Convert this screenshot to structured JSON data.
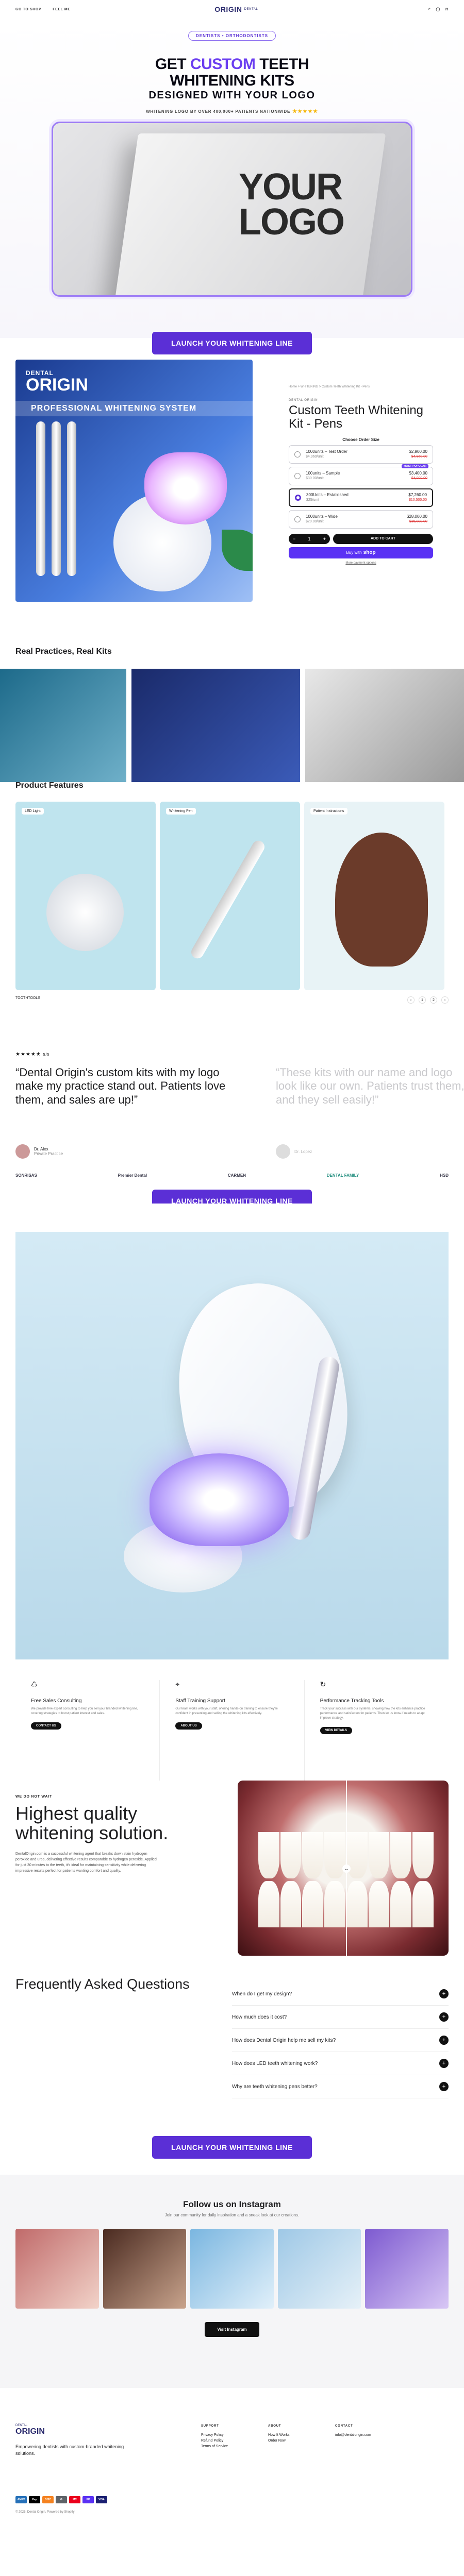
{
  "header": {
    "nav": [
      "GO TO SHOP",
      "FEEL ME"
    ],
    "logo": "ORIGIN",
    "logo_small": "DENTAL"
  },
  "hero": {
    "pill": "DENTISTS • ORTHODONTISTS",
    "title_pre": "GET ",
    "title_accent": "CUSTOM",
    "title_post": " TEETH",
    "title_line2": "WHITENING KITS",
    "subtitle": "DESIGNED WITH YOUR LOGO",
    "trust": "WHITENING LOGO BY OVER 400,000+ PATIENTS NATIONWIDE",
    "stars": "★★★★★",
    "card_text": "YOUR LOGO",
    "cta": "LAUNCH YOUR WHITENING LINE"
  },
  "product": {
    "img_brand_small": "DENTAL",
    "img_brand": "ORIGIN",
    "img_band": "PROFESSIONAL WHITENING SYSTEM",
    "crumb": "Home > WHITENING > Custom Teeth Whitening Kit - Pens",
    "category": "DENTAL ORIGIN",
    "title": "Custom Teeth Whitening Kit - Pens",
    "order_size": "Choose Order Size",
    "options": [
      {
        "name": "1000units – Test Order",
        "sub": "$4,960/unit",
        "price": "$2,900.00",
        "old": "$4,960.00",
        "tag": ""
      },
      {
        "name": "100units – Sample",
        "sub": "$30.00/unit",
        "price": "$3,400.00",
        "old": "$4,000.00",
        "tag": "MOST POPULAR"
      },
      {
        "name": "300Units – Established",
        "sub": "$25/unit",
        "price": "$7,260.00",
        "old": "$10,500.00",
        "tag": ""
      },
      {
        "name": "1000units – Wide",
        "sub": "$20.00/unit",
        "price": "$28,000.00",
        "old": "$35,000.00",
        "tag": ""
      }
    ],
    "qty": "1",
    "atc": "ADD TO CART",
    "shop_pre": "Buy with",
    "shop_brand": "shop",
    "more": "More payment options"
  },
  "real": {
    "title": "Real Practices, Real Kits"
  },
  "features": {
    "title": "Product Features",
    "cards": [
      {
        "label": "LED Light"
      },
      {
        "label": "Whitening Pen"
      },
      {
        "label": "Patient Instructions"
      }
    ],
    "page": "TOOTHTOOLS",
    "pager": [
      "1",
      "2"
    ]
  },
  "testimonial": {
    "stars": "★★★★★",
    "count": "5/5",
    "quote": "“Dental Origin's custom kits with my logo make my practice stand out. Patients love them, and sales are up!”",
    "quote2": "“These kits with our name and logo look like our own. Patients trust them, and they sell easily!”",
    "author": "Dr. Alex",
    "author_role": "Private Practice",
    "author2": "Dr. Lopez",
    "logos": [
      "SONRISAS",
      "Premier Dental",
      "CARMEN",
      "DENTAL FAMILY",
      "HSD"
    ]
  },
  "cta2": "LAUNCH YOUR WHITENING LINE",
  "services": [
    {
      "icon": "♺",
      "title": "Free Sales Consulting",
      "text": "We provide free expert consulting to help you sell your branded whitening line, covering strategies to boost patient interest and sales.",
      "btn": "CONTACT US"
    },
    {
      "icon": "⌖",
      "title": "Staff Training Support",
      "text": "Our team works with your staff, offering hands-on training to ensure they're confident in presenting and selling the whitening kits effectively.",
      "btn": "ABOUT US"
    },
    {
      "icon": "↻",
      "title": "Performance Tracking Tools",
      "text": "Track your success with our systems, showing how the kits enhance practice performance and satisfaction for patients. Then let us know if needs to adapt improve strategy.",
      "btn": "VIEW DETAILS"
    }
  ],
  "quality": {
    "kicker": "WE DO NOT WAIT",
    "title": "Highest quality whitening solution.",
    "text": "DentalOrigin.com is a successful whitening agent that breaks down stain hydrogen peroxide and urea, delivering effective results comparable to hydrogen peroxide. Applied for just 30 minutes to the teeth, it's ideal for maintaining sensitivity while delivering impressive results perfect for patients wanting comfort and quality."
  },
  "faq": {
    "title": "Frequently Asked Questions",
    "items": [
      "When do I get my design?",
      "How much does it cost?",
      "How does Dental Origin help me sell my kits?",
      "How does LED teeth whitening work?",
      "Why are teeth whitening pens better?"
    ]
  },
  "cta3": "LAUNCH YOUR WHITENING LINE",
  "instagram": {
    "title": "Follow us on Instagram",
    "sub": "Join our community for daily inspiration and a sneak look at our creations.",
    "btn": "Visit Instagram"
  },
  "footer": {
    "tagline": "Empowering dentists with custom-branded whitening solutions.",
    "cols": [
      {
        "head": "SUPPORT",
        "items": [
          "Privacy Policy",
          "Refund Policy",
          "Terms of Service"
        ]
      },
      {
        "head": "ABOUT",
        "items": [
          "How It Works",
          "Order Now"
        ]
      },
      {
        "head": "CONTACT",
        "items": [
          "info@dentalorigin.com"
        ]
      }
    ],
    "copyright": "© 2025, Dental Origin. Powered by Shopify",
    "payments": [
      "AMEX",
      "Pay",
      "DISC",
      "G",
      "MC",
      "PP",
      "VISA"
    ]
  },
  "colors": {
    "accent": "#5b2fd6",
    "accent_light": "#9d7cf5"
  }
}
